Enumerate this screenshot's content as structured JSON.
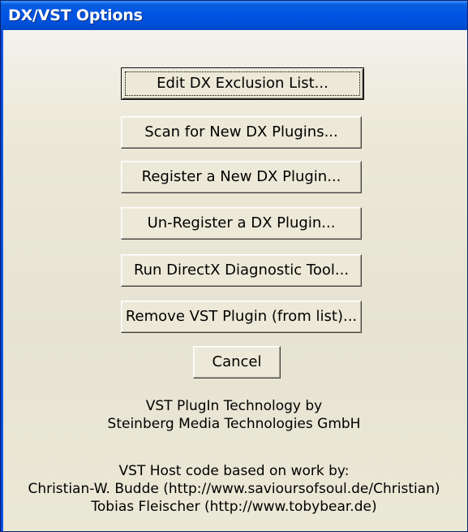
{
  "window": {
    "title": "DX/VST Options"
  },
  "buttons": {
    "edit_exclusion": "Edit DX Exclusion List...",
    "scan_plugins": "Scan for New DX Plugins...",
    "register_plugin": "Register a New DX Plugin...",
    "unregister_plugin": "Un-Register a DX Plugin...",
    "run_diagnostic": "Run DirectX Diagnostic Tool...",
    "remove_vst": "Remove VST Plugin (from list)...",
    "cancel": "Cancel"
  },
  "credits": {
    "vst_tech_line1": "VST PlugIn Technology by",
    "vst_tech_line2": "Steinberg Media Technologies GmbH",
    "host_line1": "VST Host code based on work by:",
    "host_line2": "Christian-W. Budde (http://www.savioursofsoul.de/Christian)",
    "host_line3": "Tobias Fleischer (http://www.tobybear.de)"
  },
  "colors": {
    "titlebar": "#0054e3",
    "dialog_face": "#ece9d8",
    "title_text": "#ffffff"
  }
}
